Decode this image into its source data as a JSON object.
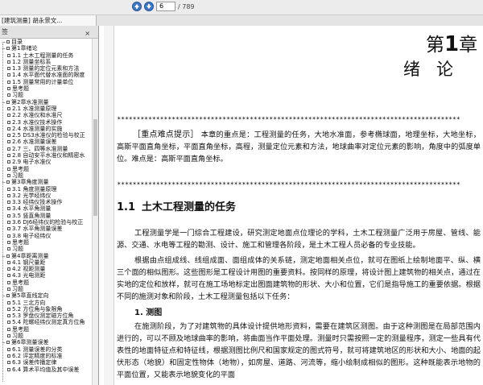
{
  "toolbar": {
    "page_current": "6",
    "page_total": "/ 789"
  },
  "tab": {
    "title": "[建筑测量] 胡永景文..."
  },
  "sidebar": {
    "header": "签",
    "close_symbol": "×",
    "items": [
      {
        "expander": "−",
        "indent": 0,
        "label": "目录"
      },
      {
        "expander": "−",
        "indent": 0,
        "label": "第1章绪论"
      },
      {
        "expander": "",
        "indent": 1,
        "label": "1.1  土木工程测量的任务"
      },
      {
        "expander": "",
        "indent": 1,
        "label": "1.2  测量坐标系"
      },
      {
        "expander": "",
        "indent": 1,
        "label": "1.3  测量的定位元素和方法"
      },
      {
        "expander": "",
        "indent": 1,
        "label": "1.4  水平面代替水准面的限度"
      },
      {
        "expander": "",
        "indent": 1,
        "label": "1.5  测量常用的计量单位"
      },
      {
        "expander": "",
        "indent": 1,
        "label": "思考题"
      },
      {
        "expander": "",
        "indent": 1,
        "label": "习题"
      },
      {
        "expander": "−",
        "indent": 0,
        "label": "第2章水准测量"
      },
      {
        "expander": "",
        "indent": 1,
        "label": "2.1  水准测量原理"
      },
      {
        "expander": "",
        "indent": 1,
        "label": "2.2  水准仪和水准尺"
      },
      {
        "expander": "",
        "indent": 1,
        "label": "2.3  水准仪技术操作"
      },
      {
        "expander": "",
        "indent": 1,
        "label": "2.4  水准测量的实施"
      },
      {
        "expander": "",
        "indent": 1,
        "label": "2.5  DS3水准仪的检验与校正"
      },
      {
        "expander": "",
        "indent": 1,
        "label": "2.6  水准测量误差"
      },
      {
        "expander": "",
        "indent": 1,
        "label": "2.7  三、四等水准测量"
      },
      {
        "expander": "",
        "indent": 1,
        "label": "2.8  自动安平水准仪和精密水"
      },
      {
        "expander": "",
        "indent": 1,
        "label": "2.9  电子水准仪"
      },
      {
        "expander": "",
        "indent": 1,
        "label": "思考题"
      },
      {
        "expander": "",
        "indent": 1,
        "label": "习题"
      },
      {
        "expander": "−",
        "indent": 0,
        "label": "第3章角度测量"
      },
      {
        "expander": "",
        "indent": 1,
        "label": "3.1  角度测量原理"
      },
      {
        "expander": "",
        "indent": 1,
        "label": "3.2  光学经纬仪"
      },
      {
        "expander": "",
        "indent": 1,
        "label": "3.3  经纬仪技术操作"
      },
      {
        "expander": "",
        "indent": 1,
        "label": "3.4  水平角测量"
      },
      {
        "expander": "",
        "indent": 1,
        "label": "3.5  竖直角测量"
      },
      {
        "expander": "",
        "indent": 1,
        "label": "3.6  DJ6经纬仪的检验与校正"
      },
      {
        "expander": "",
        "indent": 1,
        "label": "3.7  水平角测量误差"
      },
      {
        "expander": "",
        "indent": 1,
        "label": "3.8  电子经纬仪"
      },
      {
        "expander": "",
        "indent": 1,
        "label": "思考题"
      },
      {
        "expander": "",
        "indent": 1,
        "label": "习题"
      },
      {
        "expander": "−",
        "indent": 0,
        "label": "第4章距离测量"
      },
      {
        "expander": "",
        "indent": 1,
        "label": "4.1  钢尺量距"
      },
      {
        "expander": "",
        "indent": 1,
        "label": "4.2  视距测量"
      },
      {
        "expander": "",
        "indent": 1,
        "label": "4.3  光电测距"
      },
      {
        "expander": "",
        "indent": 1,
        "label": "思考题"
      },
      {
        "expander": "",
        "indent": 1,
        "label": "习题"
      },
      {
        "expander": "−",
        "indent": 0,
        "label": "第5章直线定向"
      },
      {
        "expander": "",
        "indent": 1,
        "label": "5.1  三北方向"
      },
      {
        "expander": "",
        "indent": 1,
        "label": "5.2  方位角与象限角"
      },
      {
        "expander": "",
        "indent": 1,
        "label": "5.3  罗盘仪测定磁方位角"
      },
      {
        "expander": "",
        "indent": 1,
        "label": "5.4  陀螺经纬仪测定真方位角"
      },
      {
        "expander": "",
        "indent": 1,
        "label": "思考题"
      },
      {
        "expander": "",
        "indent": 1,
        "label": "习题"
      },
      {
        "expander": "−",
        "indent": 0,
        "label": "第6章测量误差"
      },
      {
        "expander": "",
        "indent": 1,
        "label": "6.1  测量误差的分类"
      },
      {
        "expander": "",
        "indent": 1,
        "label": "6.2  评定精度的标准"
      },
      {
        "expander": "",
        "indent": 1,
        "label": "6.3  误差传播定律"
      },
      {
        "expander": "",
        "indent": 1,
        "label": "6.4  算术平均值及其中误差"
      }
    ]
  },
  "page": {
    "chapter_prefix": "第",
    "chapter_number": "1",
    "chapter_suffix": "章",
    "chapter_title": "绪论",
    "stars": "✶✶✶✶✶✶✶✶✶✶✶✶✶✶✶✶✶✶✶✶✶✶✶✶✶✶✶✶✶✶✶✶✶✶✶✶✶✶✶✶✶✶✶✶✶✶✶✶✶✶✶✶✶✶✶✶✶✶✶✶✶✶✶✶✶✶✶✶✶✶✶✶✶✶✶✶✶✶✶✶✶✶✶✶✶✶✶✶",
    "key_label": "［重点难点提示］",
    "key_text": " 本章的重点是：工程测量的任务，大地水准面，参考椭球面，地理坐标，大地坐标，高斯平面直角坐标，平面直角坐标，高程，测量定位元素和方法，地球曲率对定位元素的影响，角度中的弧度单位。难点是：高斯平面直角坐标。",
    "section_number": "1.1",
    "section_title": "土木工程测量的任务",
    "para1": "工程测量学是一门综合工程建设，研究测定地面点位理论的学科，土木工程测量广泛用于房屋、管线、能源、交通、水电等工程的勘测、设计、施工和管理各阶段，是土木工程人员必备的专业技能。",
    "para2": "根据由点组成线、线组成面、面组成体的关系链，测定地面相关点位，就可在图纸上绘制地面平、纵、横三个面的相似图形。这些图形是工程设计用图的重要资料。按同样的原理，将设计图上建筑物的相关点，通过在实地的定位和放样，就可在施工场地标定出图面建筑物的形状、大小和位置，它们是指导施工的重要依据。根据不同的施测对象和阶段，土木工程测量包括以下任务：",
    "sub_heading": "1. 测图",
    "para3": "在施测阶段，为了对建筑物的具体设计提供地形资料，需要在建筑区测图。由于这种测图是在局部范围内进行的，可以不顾及地球曲率的影响，将曲面当作平面处理。测量时只需按照一定的测量程序，测定一些具有代表性的地面特征点和特征线，根据测图比例尺和国家规定的图式符号，就可将建筑地区的形状和大小、地面的起伏形态（地貌）和固定性物体（地物），如房屋、道路、河流等，缩小绘制成相似的图形。这种既能表示地物的平面位置，又能表示地貌变化的平面"
  }
}
